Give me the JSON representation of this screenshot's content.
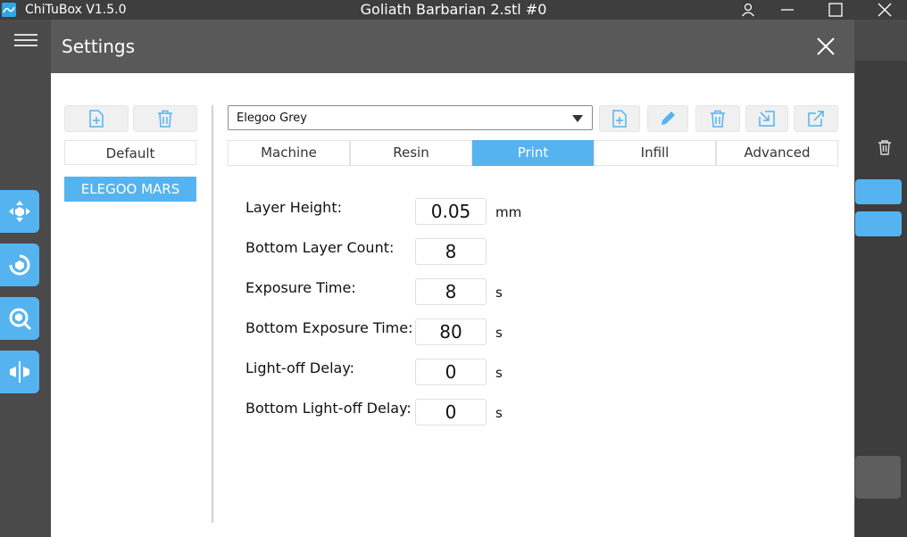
{
  "window": {
    "app_name": "ChiTuBox V1.5.0",
    "document_title": "Goliath Barbarian 2.stl #0",
    "icons": [
      "app-logo-icon",
      "user-icon",
      "minimize-icon",
      "maximize-icon",
      "close-icon"
    ]
  },
  "background_app": {
    "icons": [
      "menu-icon",
      "move-tool-icon",
      "rotate-tool-icon",
      "scale-tool-icon",
      "mirror-tool-icon",
      "delete-icon"
    ]
  },
  "dialog": {
    "title": "Settings",
    "machine_profiles": {
      "items": [
        {
          "label": "Default",
          "selected": false
        },
        {
          "label": "ELEGOO MARS",
          "selected": true
        }
      ]
    },
    "resin_profile": {
      "selected": "Elegoo Grey"
    },
    "tabs": [
      {
        "label": "Machine",
        "active": false
      },
      {
        "label": "Resin",
        "active": false
      },
      {
        "label": "Print",
        "active": true
      },
      {
        "label": "Infill",
        "active": false
      },
      {
        "label": "Advanced",
        "active": false
      }
    ],
    "print_settings": [
      {
        "label": "Layer Height:",
        "value": "0.05",
        "unit": "mm"
      },
      {
        "label": "Bottom Layer Count:",
        "value": "8",
        "unit": ""
      },
      {
        "label": "Exposure Time:",
        "value": "8",
        "unit": "s"
      },
      {
        "label": "Bottom Exposure Time:",
        "value": "80",
        "unit": "s"
      },
      {
        "label": "Light-off Delay:",
        "value": "0",
        "unit": "s"
      },
      {
        "label": "Bottom Light-off Delay:",
        "value": "0",
        "unit": "s"
      }
    ]
  },
  "colors": {
    "accent": "#55b3f0",
    "titlebar": "#3e3e3e",
    "dialog_header": "#595959",
    "background": "#4a4a4a"
  }
}
